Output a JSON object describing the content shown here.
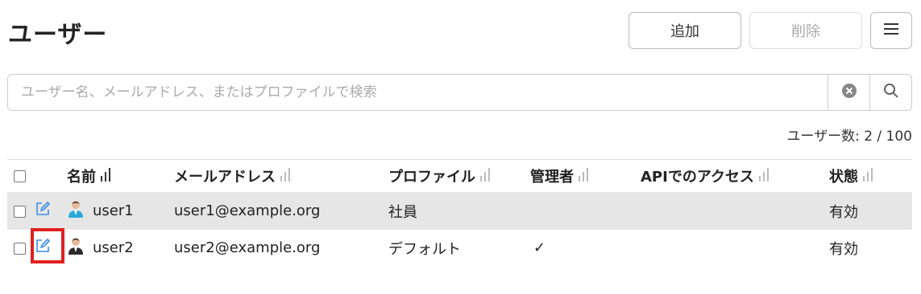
{
  "page": {
    "title": "ユーザー"
  },
  "toolbar": {
    "add_label": "追加",
    "delete_label": "削除",
    "menu_icon": "hamburger-icon"
  },
  "search": {
    "placeholder": "ユーザー名、メールアドレス、またはプロファイルで検索",
    "value": ""
  },
  "user_count": "ユーザー数: 2 / 100",
  "table": {
    "columns": [
      "名前",
      "メールアドレス",
      "プロファイル",
      "管理者",
      "APIでのアクセス",
      "状態"
    ],
    "rows": [
      {
        "name": "user1",
        "email": "user1@example.org",
        "profile": "社員",
        "admin": "",
        "api": "",
        "status": "有効"
      },
      {
        "name": "user2",
        "email": "user2@example.org",
        "profile": "デフォルト",
        "admin": "✓",
        "api": "",
        "status": "有効"
      }
    ]
  },
  "colors": {
    "accent": "#3a8ee6",
    "highlight": "#e02020",
    "selected_row": "#e6e6e6"
  }
}
